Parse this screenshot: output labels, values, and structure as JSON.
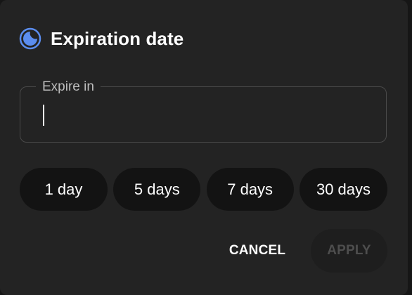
{
  "dialog": {
    "title": "Expiration date",
    "title_icon": "moon-clock-icon",
    "accent_color": "#5b8def"
  },
  "field": {
    "label": "Expire in",
    "value": "",
    "placeholder": ""
  },
  "presets": [
    {
      "label": "1 day"
    },
    {
      "label": "5 days"
    },
    {
      "label": "7 days"
    },
    {
      "label": "30 days"
    }
  ],
  "actions": {
    "cancel_label": "CANCEL",
    "apply_label": "APPLY",
    "apply_enabled": false
  }
}
